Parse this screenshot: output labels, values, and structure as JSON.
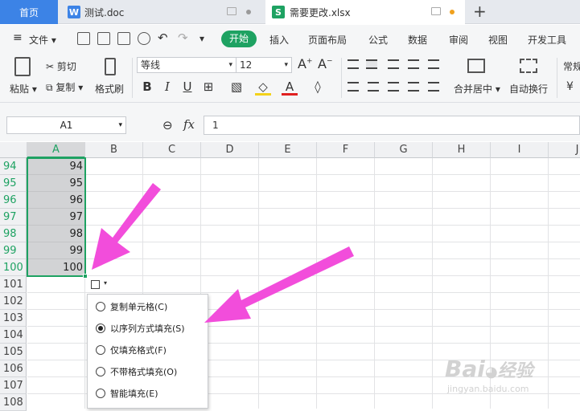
{
  "tabs": {
    "home": "首页",
    "doc": "测试.doc",
    "xlsx": "需要更改.xlsx"
  },
  "menu": {
    "file": "文件",
    "items": [
      "开始",
      "插入",
      "页面布局",
      "公式",
      "数据",
      "审阅",
      "视图",
      "开发工具"
    ]
  },
  "ribbon": {
    "paste": "粘贴",
    "cut": "剪切",
    "copy": "复制",
    "format_painter": "格式刷",
    "font_name": "等线",
    "font_size": "12",
    "merge": "合并居中",
    "wrap": "自动换行",
    "style_partial": "常规",
    "currency": "¥"
  },
  "formula": {
    "name_box": "A1",
    "fx": "fx",
    "value": "1"
  },
  "columns": [
    "A",
    "B",
    "C",
    "D",
    "E",
    "F",
    "G",
    "H",
    "I",
    "J"
  ],
  "rows": [
    "94",
    "95",
    "96",
    "97",
    "98",
    "99",
    "100",
    "101",
    "102",
    "103",
    "104",
    "105",
    "106",
    "107",
    "108"
  ],
  "values_a": [
    "94",
    "95",
    "96",
    "97",
    "98",
    "99",
    "100"
  ],
  "popup": {
    "options": [
      "复制单元格(C)",
      "以序列方式填充(S)",
      "仅填充格式(F)",
      "不带格式填充(O)",
      "智能填充(E)"
    ],
    "selected": 1
  },
  "watermark": {
    "text1": "Bai",
    "text2": "经验",
    "url": "jingyan.baidu.com"
  },
  "colors": {
    "accent_green": "#1ea262",
    "tab_blue": "#3c83e6",
    "arrow": "#f24ddb"
  }
}
